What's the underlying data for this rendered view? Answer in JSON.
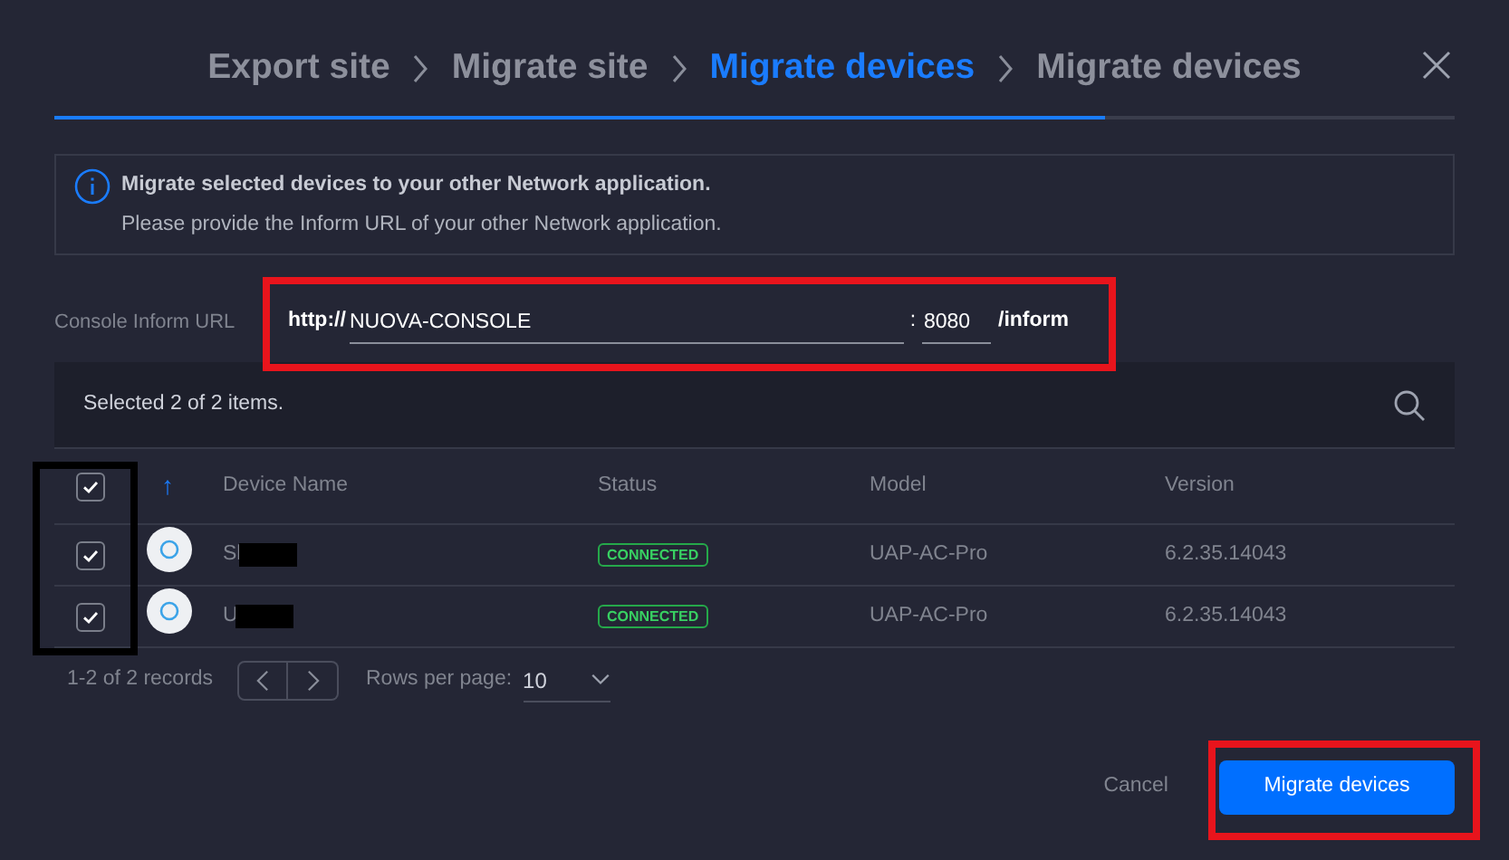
{
  "steps": [
    {
      "label": "Export site",
      "selected": false
    },
    {
      "label": "Migrate site",
      "selected": false
    },
    {
      "label": "Migrate devices",
      "selected": true
    },
    {
      "label": "Migrate devices",
      "selected": false
    }
  ],
  "progress": {
    "level": 0.75
  },
  "info": {
    "title": "Migrate selected devices to your other Network application.",
    "text": "Please provide the Inform URL of your other Network application."
  },
  "inform_url": {
    "label": "Console Inform URL",
    "scheme": "http://",
    "host": "NUOVA-CONSOLE",
    "separator": ":",
    "port": "8080",
    "suffix": "/inform"
  },
  "selection": {
    "text": "Selected 2 of 2 items."
  },
  "table": {
    "select_all": {
      "checked": true
    },
    "sort_arrow": "↑",
    "columns": [
      "Device Name",
      "Status",
      "Model",
      "Version"
    ],
    "rows": [
      {
        "checked": true,
        "name": "Sl",
        "redacted": true,
        "status": "CONNECTED",
        "model": "UAP-AC-Pro",
        "version": "6.2.35.14043"
      },
      {
        "checked": true,
        "name": "U",
        "redacted": true,
        "status": "CONNECTED",
        "model": "UAP-AC-Pro",
        "version": "6.2.35.14043"
      }
    ]
  },
  "pagination": {
    "records": "1-2 of 2 records",
    "rows_label": "Rows per page:",
    "rows_value": "10"
  },
  "buttons": [
    {
      "label": "Cancel",
      "kind": "secondary"
    },
    {
      "label": "Migrate devices",
      "kind": "primary"
    }
  ],
  "annotations": [
    {
      "kind": "url",
      "color": "#e8141c"
    },
    {
      "kind": "checkboxes",
      "color": "#000000"
    },
    {
      "kind": "button",
      "color": "#e8141c"
    }
  ]
}
